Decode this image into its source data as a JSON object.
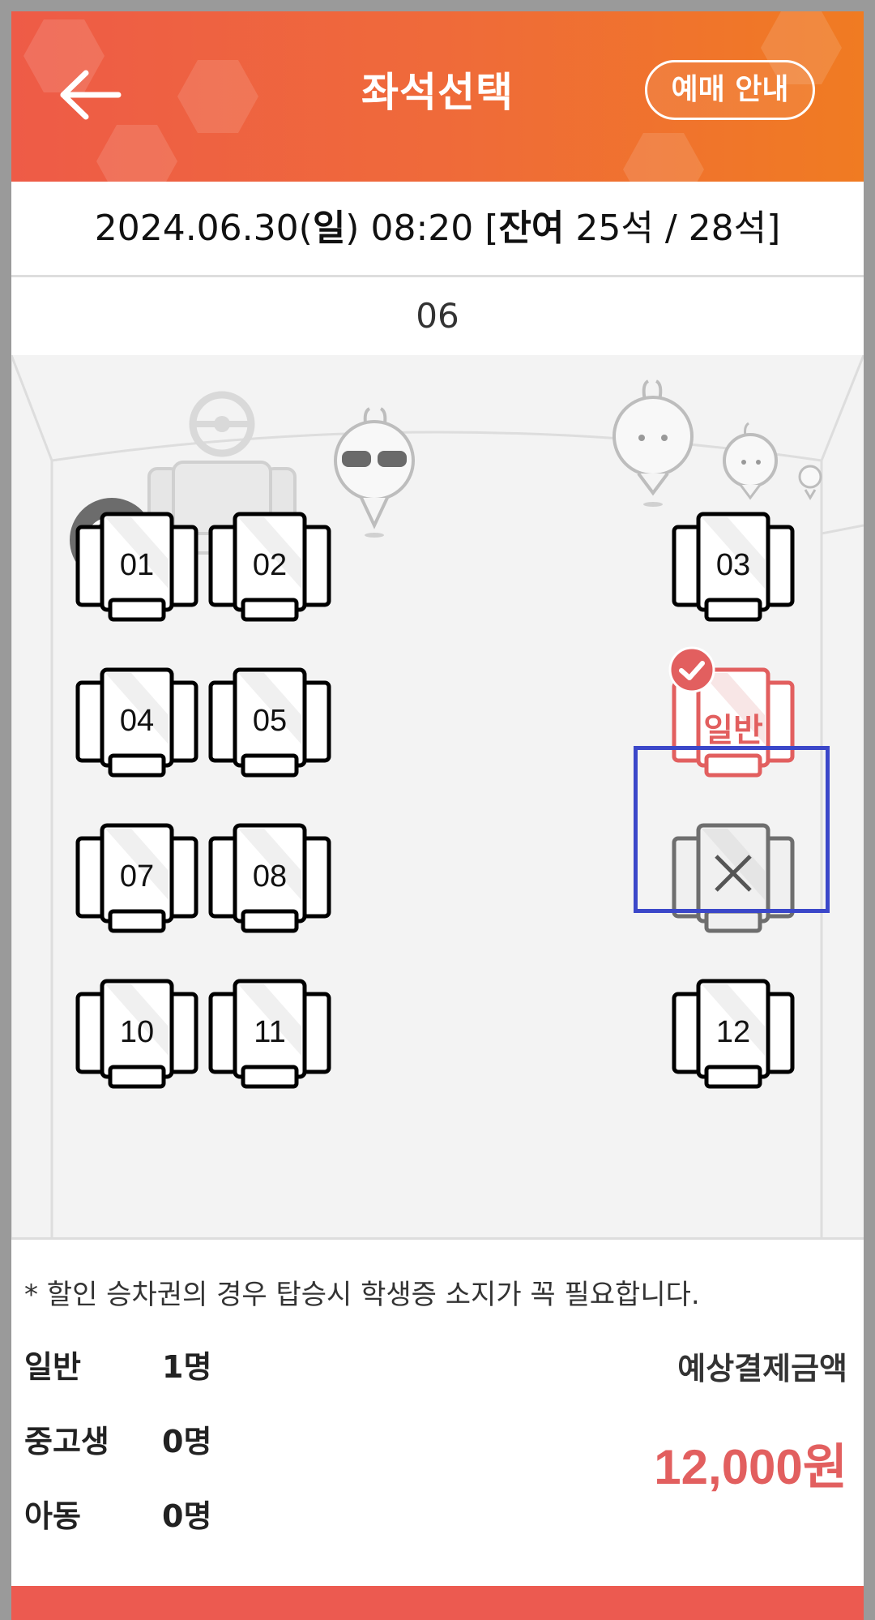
{
  "header": {
    "title": "좌석선택",
    "guide_button": "예매 안내"
  },
  "trip": {
    "date": "2024.06.30(",
    "weekday": "일",
    "time": ") 08:20 [",
    "remain_label": "잔여",
    "remain": " 25석",
    "slash": " / ",
    "total": "28석",
    "close": "]"
  },
  "bus_no": "06",
  "seats": {
    "s01": "01",
    "s02": "02",
    "s03": "03",
    "s04": "04",
    "s05": "05",
    "s06": "일반",
    "s07": "07",
    "s08": "08",
    "s10": "10",
    "s11": "11",
    "s12": "12"
  },
  "footer": {
    "notice": "* 할인 승차권의 경우 탑승시 학생증 소지가 꼭 필요합니다.",
    "adult_label": "일반",
    "adult_count": "1명",
    "student_label": "중고생",
    "student_count": "0명",
    "child_label": "아동",
    "child_count": "0명",
    "pay_label": "예상결제금액",
    "pay_amount": "12,000원"
  },
  "colors": {
    "accent": "#ec5a50",
    "selected": "#e25f5f",
    "highlight_box": "#3b47c9"
  },
  "icons": [
    "back-arrow-icon",
    "refresh-icon",
    "check-icon",
    "close-icon",
    "steering-wheel-icon"
  ]
}
